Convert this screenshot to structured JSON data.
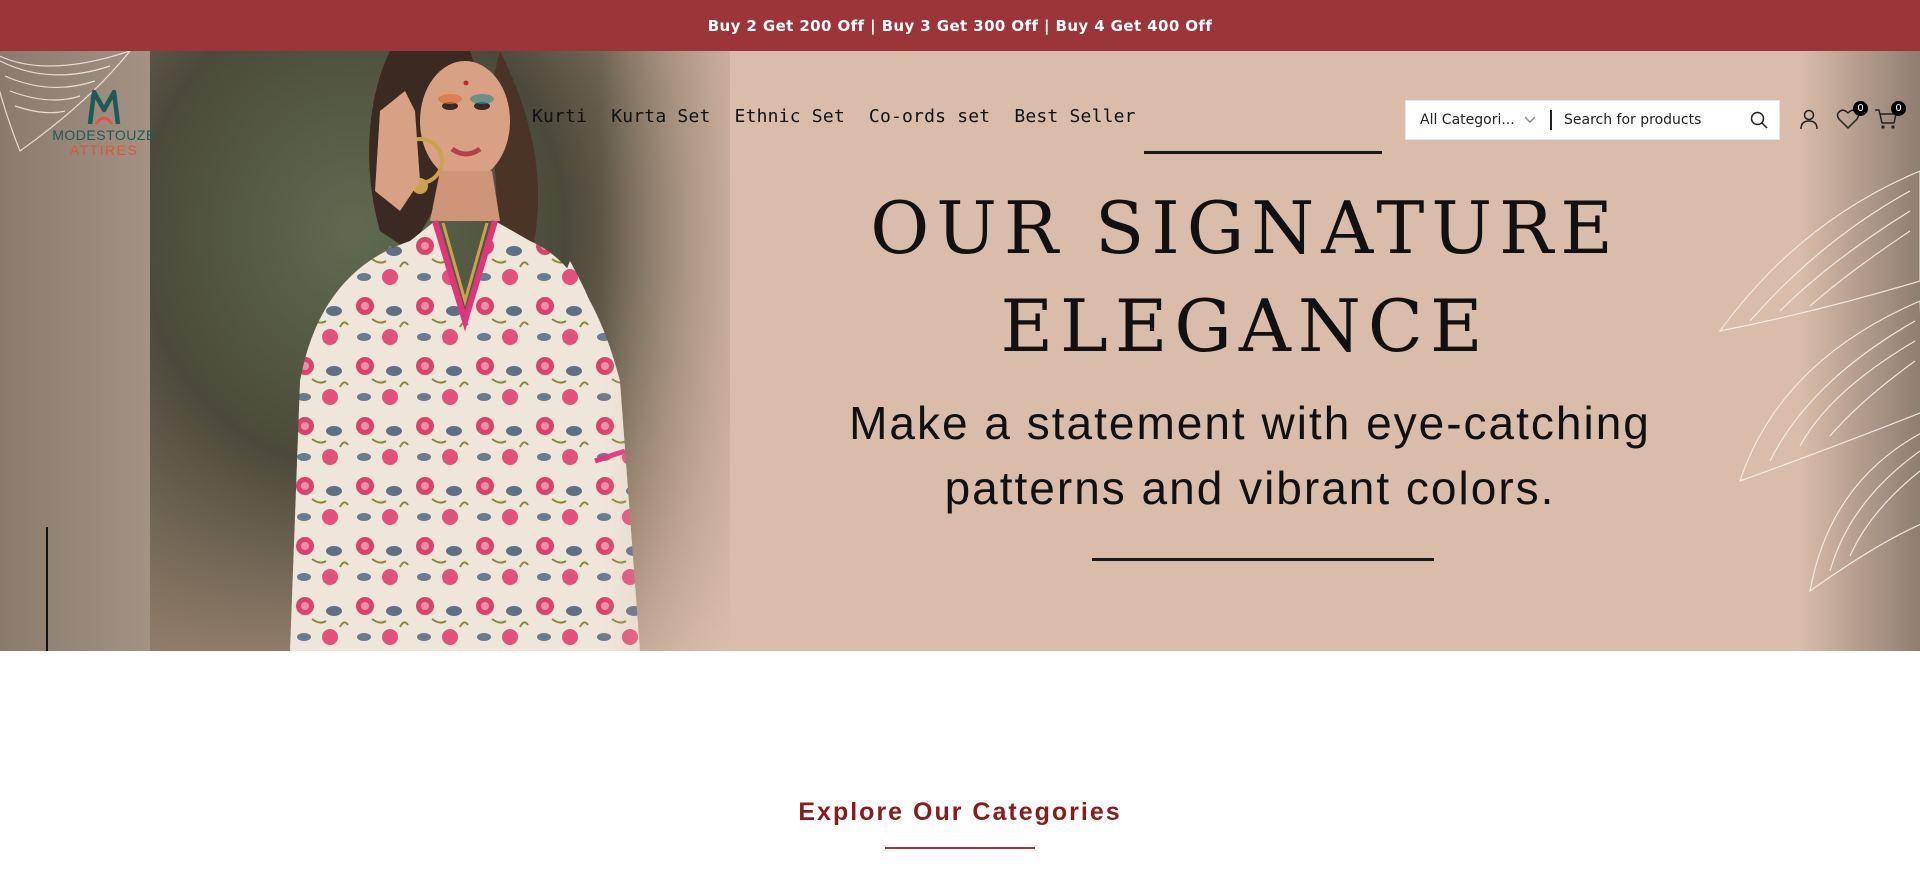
{
  "announcement": {
    "text": "Buy 2 Get 200 Off | Buy 3 Get 300 Off | Buy 4 Get 400 Off"
  },
  "logo": {
    "line1": "MODESTOUZE",
    "line2": "ATTIRES"
  },
  "nav": {
    "items": [
      {
        "label": "Kurti"
      },
      {
        "label": "Kurta Set"
      },
      {
        "label": "Ethnic Set"
      },
      {
        "label": "Co-ords set"
      },
      {
        "label": "Best Seller"
      }
    ]
  },
  "search": {
    "category_value": "All Categori...",
    "placeholder": "Search for products"
  },
  "header_icons": {
    "account_icon": "user-icon",
    "wishlist_icon": "heart-icon",
    "wishlist_count": "0",
    "cart_icon": "cart-icon",
    "cart_count": "0"
  },
  "hero": {
    "title_line1": "OUR SIGNATURE",
    "title_line2": "ELEGANCE",
    "subtitle_line1": "Make a statement with eye-catching",
    "subtitle_line2": "patterns and vibrant colors."
  },
  "categories": {
    "heading": "Explore Our Categories"
  },
  "colors": {
    "announcement_bg": "#9b3539",
    "hero_bg": "#d9bcaa",
    "heading_accent": "#8b1a1a"
  }
}
